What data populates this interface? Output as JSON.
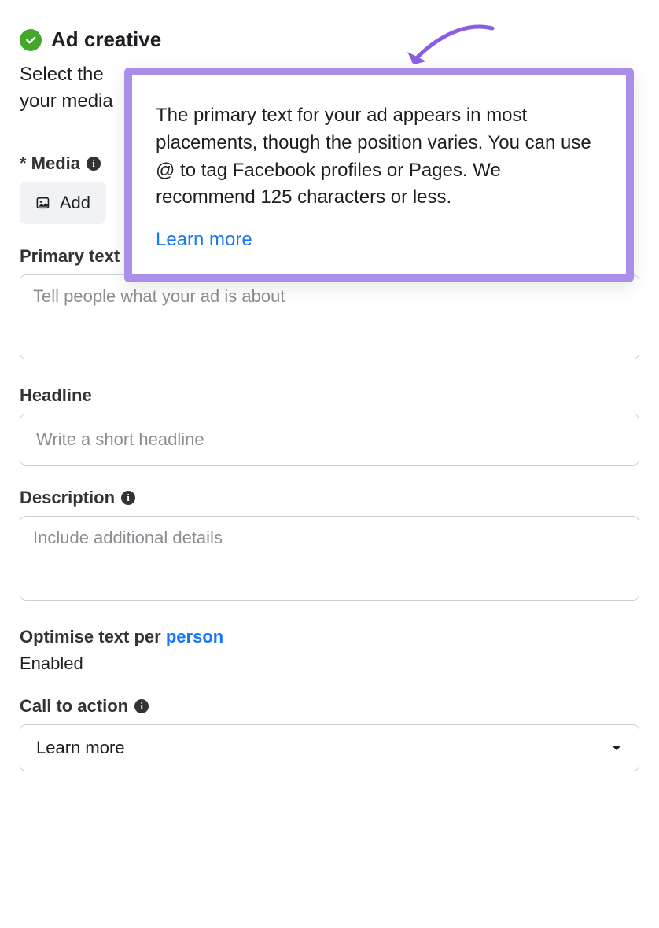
{
  "header": {
    "title": "Ad creative",
    "description_visible": "Select the \nyour media"
  },
  "popover": {
    "text": "The primary text for your ad appears in most placements, though the position varies. You can use @ to tag Facebook profiles or Pages. We recommend 125 characters or less.",
    "link": "Learn more"
  },
  "fields": {
    "media": {
      "label": "* Media",
      "button": "Add"
    },
    "primary_text": {
      "label": "Primary text",
      "placeholder": "Tell people what your ad is about"
    },
    "headline": {
      "label": "Headline",
      "placeholder": "Write a short headline"
    },
    "description": {
      "label": "Description",
      "placeholder": "Include additional details"
    },
    "optimise": {
      "label_prefix": "Optimise text per ",
      "label_link": "person",
      "value": "Enabled"
    },
    "cta": {
      "label": "Call to action",
      "selected": "Learn more"
    }
  }
}
